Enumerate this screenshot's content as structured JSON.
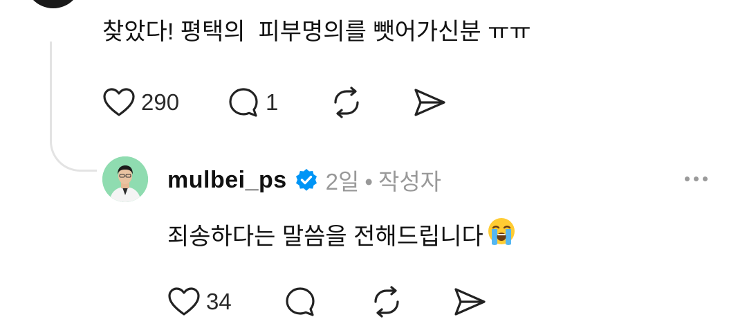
{
  "post": {
    "text": "찾았다! 평택의  피부명의를 뺏어가신분 ㅠㅠ",
    "actions": {
      "like_count": "290",
      "reply_count": "1"
    },
    "icons": [
      "heart-icon",
      "comment-icon",
      "repost-icon",
      "share-icon"
    ]
  },
  "reply": {
    "username": "mulbei_ps",
    "verified_icon": "verified-badge-icon",
    "time": "2일",
    "separator": "•",
    "author_label": "작성자",
    "text": "죄송하다는 말씀을 전해드립니다",
    "emoji": "loudly-crying-face-emoji",
    "actions": {
      "like_count": "34"
    }
  },
  "colors": {
    "verified_blue": "#0095f6",
    "meta_gray": "#999999",
    "thread_line": "#e3e3e3"
  }
}
